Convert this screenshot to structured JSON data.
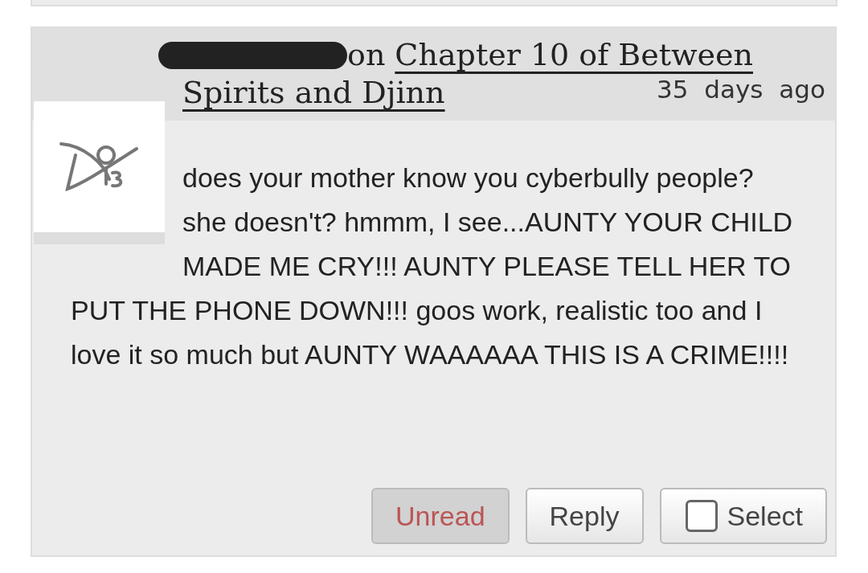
{
  "comment": {
    "author_redacted": true,
    "preposition": "on",
    "work_link_lines": [
      "Chapter 10 of Between",
      "Spirits and Djinn"
    ],
    "timestamp": "35 days ago",
    "body": "does your mother know you cyberbully people? she doesn't? hmmm, I see...AUNTY YOUR CHILD MADE ME CRY!!! AUNTY PLEASE TELL HER TO PUT THE PHONE DOWN!!! goos work, realistic too and I love it so much but AUNTY WAAAAAA THIS IS A CRIME!!!!",
    "buttons": [
      {
        "kind": "plain",
        "label": "Unread",
        "disabled": true
      },
      {
        "kind": "plain",
        "label": "Reply",
        "disabled": false
      },
      {
        "kind": "checkbox",
        "label": "Select",
        "checked": false
      }
    ]
  }
}
